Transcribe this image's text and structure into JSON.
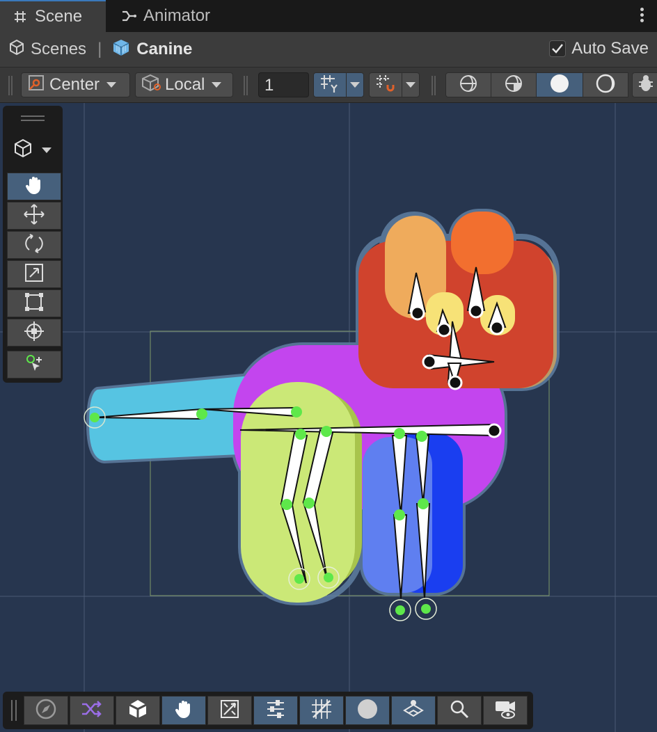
{
  "tabs": [
    {
      "label": "Scene",
      "icon": "grid-hash-icon",
      "active": true
    },
    {
      "label": "Animator",
      "icon": "animator-icon",
      "active": false
    }
  ],
  "breadcrumb": {
    "root": "Scenes",
    "separator": "|",
    "current": "Canine"
  },
  "autosave": {
    "label": "Auto Save",
    "checked": true
  },
  "toolbar": {
    "pivot_mode": "Center",
    "pivot_rotation": "Local",
    "grid_snap_value": "1"
  },
  "colors": {
    "scene_background": "#27364f",
    "selection_accent": "#46607c",
    "bone_joint": "#5ee84a"
  },
  "scene_tools": [
    "hand-tool",
    "move-tool",
    "rotate-tool",
    "scale-tool",
    "rect-tool",
    "transform-tool",
    "custom-editor-tool"
  ],
  "bottom_tools": [
    "orientation",
    "shuffle-fx",
    "unity-cube",
    "hand",
    "skeleton-editor",
    "properties",
    "grid-snapping",
    "shaded-mode",
    "layers",
    "search",
    "camera-visibility"
  ]
}
